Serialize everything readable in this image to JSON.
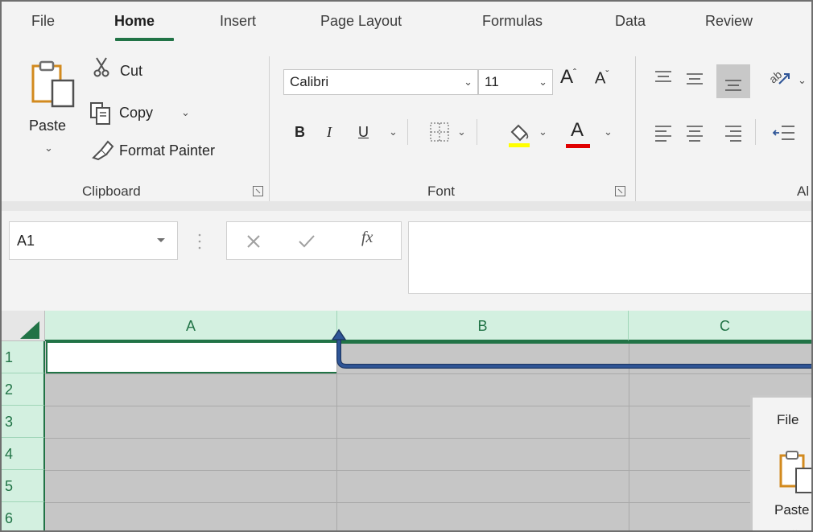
{
  "tabs": [
    {
      "label": "File"
    },
    {
      "label": "Home",
      "active": true
    },
    {
      "label": "Insert"
    },
    {
      "label": "Page Layout"
    },
    {
      "label": "Formulas"
    },
    {
      "label": "Data"
    },
    {
      "label": "Review"
    }
  ],
  "clipboard": {
    "paste_label": "Paste",
    "cut_label": "Cut",
    "copy_label": "Copy",
    "format_painter_label": "Format Painter",
    "group_label": "Clipboard"
  },
  "font": {
    "name": "Calibri",
    "size": "11",
    "bold_glyph": "B",
    "italic_glyph": "I",
    "underline_glyph": "U",
    "font_color_glyph": "A",
    "group_label": "Font",
    "fill_color": "#ffff00",
    "text_color": "#e00000"
  },
  "alignment": {
    "group_label": "Al"
  },
  "formula_bar": {
    "name_box": "A1",
    "fx_glyph": "fx",
    "formula": ""
  },
  "sheet": {
    "columns": [
      "A",
      "B",
      "C"
    ],
    "rows": [
      "1",
      "2",
      "3",
      "4",
      "5",
      "6"
    ],
    "selected_cell": "A1"
  },
  "inset_ribbon": {
    "file_label": "File",
    "paste_label": "Paste"
  },
  "colors": {
    "accent": "#217346",
    "arrow": "#2f5597"
  }
}
